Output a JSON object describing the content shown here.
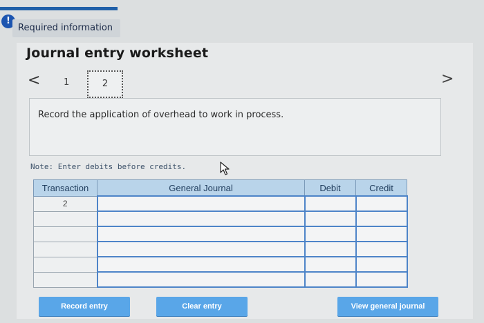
{
  "header": {
    "required_info": "Required information"
  },
  "worksheet": {
    "title": "Journal entry worksheet",
    "pages": [
      "1",
      "2"
    ],
    "nav_prev": "<",
    "nav_next": ">",
    "instruction": "Record the application of overhead to work in process.",
    "note": "Note: Enter debits before credits."
  },
  "journal": {
    "columns": [
      "Transaction",
      "General Journal",
      "Debit",
      "Credit"
    ],
    "rows": [
      {
        "transaction": "2"
      },
      {
        "transaction": ""
      },
      {
        "transaction": ""
      },
      {
        "transaction": ""
      },
      {
        "transaction": ""
      },
      {
        "transaction": ""
      }
    ]
  },
  "buttons": {
    "record": "Record entry",
    "clear": "Clear entry",
    "view": "View general journal"
  },
  "icons": {
    "alert": "exclamation-icon",
    "cursor": "mouse-pointer-icon"
  },
  "colors": {
    "accent": "#59a6e8",
    "header_blue": "#b9d4ea",
    "alert_blue": "#1c55b0"
  }
}
